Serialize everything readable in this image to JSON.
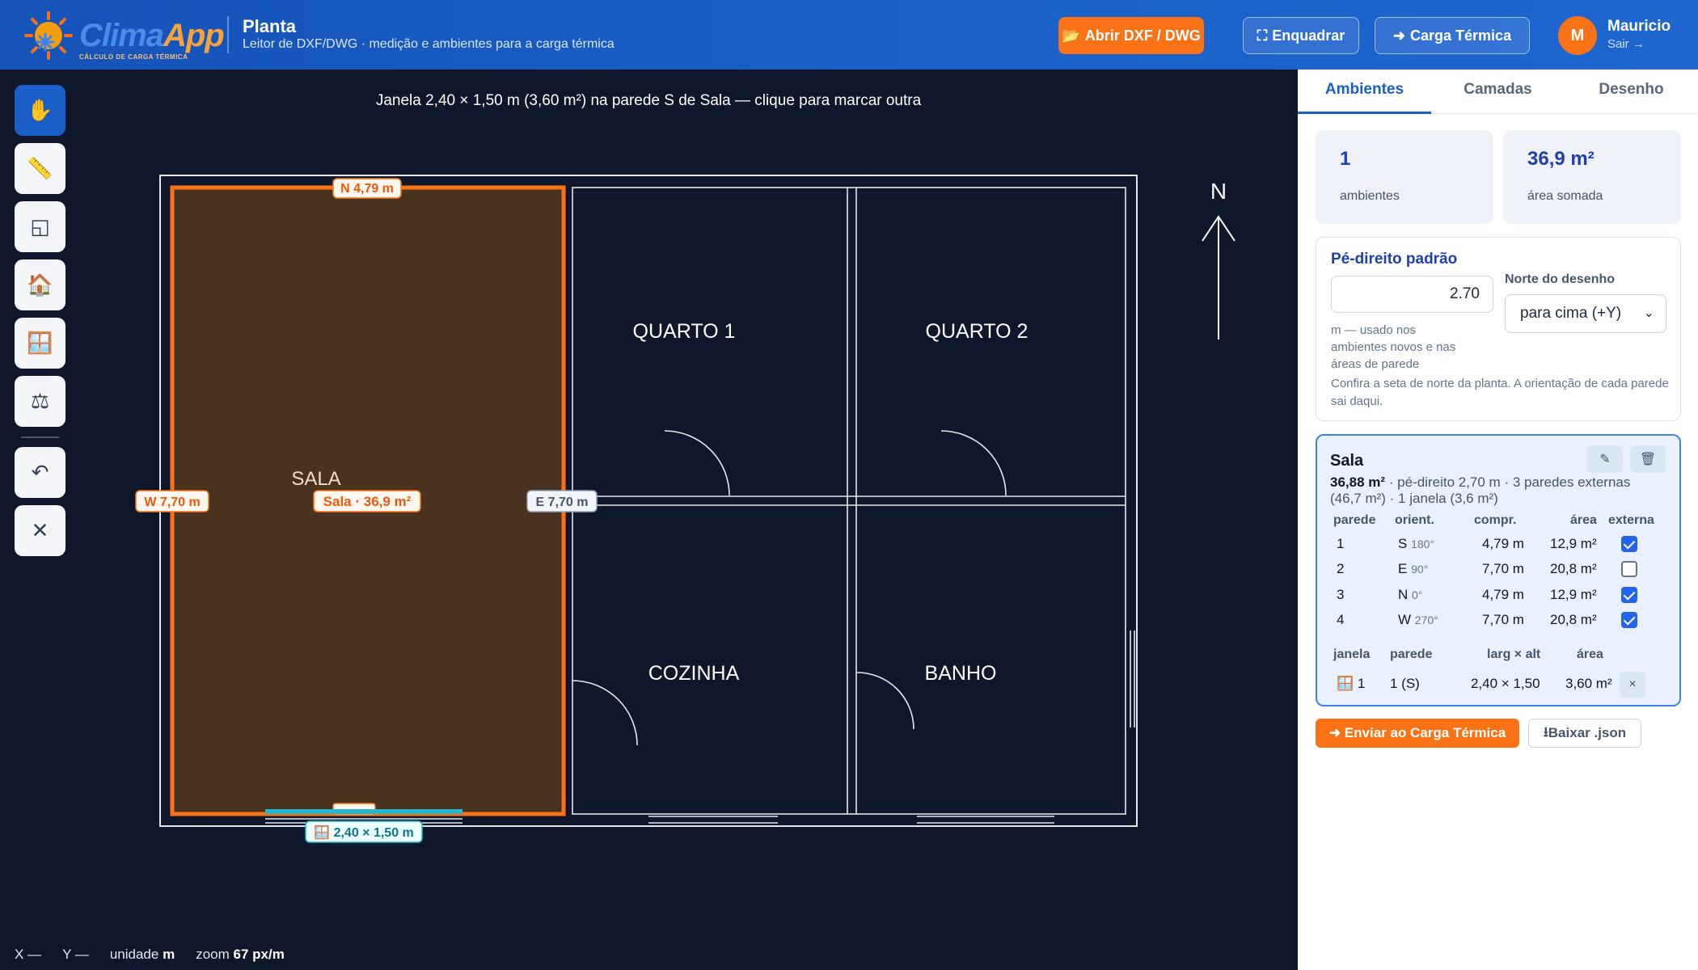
{
  "app": {
    "logo_text_a": "Clima",
    "logo_text_b": "App",
    "logo_tagline": "CÁLCULO DE CARGA TÉRMICA",
    "title": "Planta",
    "subtitle": "Leitor de DXF/DWG · medição e ambientes para a carga térmica"
  },
  "header": {
    "open_label": "Abrir DXF / DWG",
    "fit_label": "Enquadrar",
    "thermal_label": "Carga Térmica",
    "user_initial": "M",
    "user_name": "Mauricio",
    "logout_label": "Sair →"
  },
  "toolbar": {
    "tools": [
      {
        "name": "pan",
        "icon": "hand-icon",
        "glyph": "✋",
        "active": true
      },
      {
        "name": "measure",
        "icon": "ruler-icon",
        "glyph": "📏",
        "active": false
      },
      {
        "name": "area",
        "icon": "area-icon",
        "glyph": "◱",
        "active": false
      },
      {
        "name": "room",
        "icon": "house-icon",
        "glyph": "🏠",
        "active": false
      },
      {
        "name": "window",
        "icon": "window-icon",
        "glyph": "🪟",
        "active": false
      },
      {
        "name": "scale",
        "icon": "balance-icon",
        "glyph": "⚖",
        "active": false
      }
    ],
    "undo_glyph": "↶",
    "close_glyph": "✕"
  },
  "canvas": {
    "status": "Janela 2,40 × 1,50 m (3,60 m²) na parede S de Sala — clique para marcar outra",
    "rooms": [
      "SALA",
      "QUARTO 1",
      "QUARTO 2",
      "COZINHA",
      "BANHO"
    ],
    "north_letter": "N",
    "labels": {
      "north_wall": "N 4,79 m",
      "west_wall": "W 7,70 m",
      "east_wall": "E 7,70 m",
      "room_area": "Sala · 36,9 m²",
      "window": "🪟 2,40 × 1,50 m"
    },
    "colors": {
      "selected_fill": "#4a331e",
      "selected_stroke": "#f97316",
      "window": "#22b8cf"
    }
  },
  "coords": {
    "x_label": "X —",
    "y_label": "Y —",
    "unit_label": "unidade",
    "unit_value": "m",
    "zoom_label": "zoom",
    "zoom_value": "67 px/m"
  },
  "panel": {
    "tabs": [
      "Ambientes",
      "Camadas",
      "Desenho"
    ],
    "stats": [
      {
        "value": "1",
        "label": "ambientes"
      },
      {
        "value": "36,9 m²",
        "label": "área somada"
      }
    ],
    "ceiling": {
      "title": "Pé-direito padrão",
      "value": "2.70",
      "help": "m — usado nos ambientes novos e nas áreas de parede",
      "north_label": "Norte do desenho",
      "north_value": "para cima (+Y)",
      "north_help": "Confira a seta de norte da planta. A orientação de cada parede sai daqui."
    },
    "room": {
      "name": "Sala",
      "area_bold": "36,88 m²",
      "summary": " · pé-direito 2,70 m · 3 paredes externas (46,7 m²) · 1 janela (3,6 m²)",
      "wall_headers": [
        "parede",
        "orient.",
        "compr.",
        "área",
        "externa"
      ],
      "walls": [
        {
          "n": "1",
          "dir": "S",
          "deg": "180°",
          "len": "4,79 m",
          "area": "12,9 m²",
          "ext": true
        },
        {
          "n": "2",
          "dir": "E",
          "deg": "90°",
          "len": "7,70 m",
          "area": "20,8 m²",
          "ext": false
        },
        {
          "n": "3",
          "dir": "N",
          "deg": "0°",
          "len": "4,79 m",
          "area": "12,9 m²",
          "ext": true
        },
        {
          "n": "4",
          "dir": "W",
          "deg": "270°",
          "len": "7,70 m",
          "area": "20,8 m²",
          "ext": true
        }
      ],
      "window_headers": [
        "janela",
        "parede",
        "larg × alt",
        "área"
      ],
      "windows": [
        {
          "n": "1",
          "wall": "1 (S)",
          "size": "2,40 × 1,50",
          "area": "3,60 m²"
        }
      ]
    },
    "send_label": "Enviar ao Carga Térmica",
    "json_label": "Baixar .json"
  }
}
